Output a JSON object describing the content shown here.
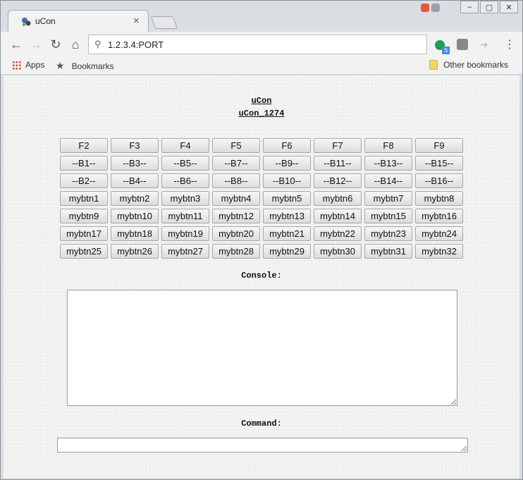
{
  "browser": {
    "tab_title": "uCon",
    "tab_close": "×",
    "url": "1.2.3.4:PORT",
    "badge_text": "S",
    "bookmarks": {
      "apps": "Apps",
      "bookmarks": "Bookmarks",
      "other": "Other bookmarks"
    },
    "window_controls": [
      "–",
      "▢",
      "✕"
    ]
  },
  "page": {
    "title": "uCon",
    "subtitle": "uCon_1274",
    "buttons": [
      [
        "F2",
        "F3",
        "F4",
        "F5",
        "F6",
        "F7",
        "F8",
        "F9"
      ],
      [
        "--B1--",
        "--B3--",
        "--B5--",
        "--B7--",
        "--B9--",
        "--B11--",
        "--B13--",
        "--B15--"
      ],
      [
        "--B2--",
        "--B4--",
        "--B6--",
        "--B8--",
        "--B10--",
        "--B12--",
        "--B14--",
        "--B16--"
      ],
      [
        "mybtn1",
        "mybtn2",
        "mybtn3",
        "mybtn4",
        "mybtn5",
        "mybtn6",
        "mybtn7",
        "mybtn8"
      ],
      [
        "mybtn9",
        "mybtn10",
        "mybtn11",
        "mybtn12",
        "mybtn13",
        "mybtn14",
        "mybtn15",
        "mybtn16"
      ],
      [
        "mybtn17",
        "mybtn18",
        "mybtn19",
        "mybtn20",
        "mybtn21",
        "mybtn22",
        "mybtn23",
        "mybtn24"
      ],
      [
        "mybtn25",
        "mybtn26",
        "mybtn27",
        "mybtn28",
        "mybtn29",
        "mybtn30",
        "mybtn31",
        "mybtn32"
      ]
    ],
    "console_label": "Console:",
    "console_value": "",
    "command_label": "Command:",
    "command_value": ""
  },
  "colors": {
    "page_bg": "#f3f3f3",
    "button_border": "#a7a7a7"
  }
}
